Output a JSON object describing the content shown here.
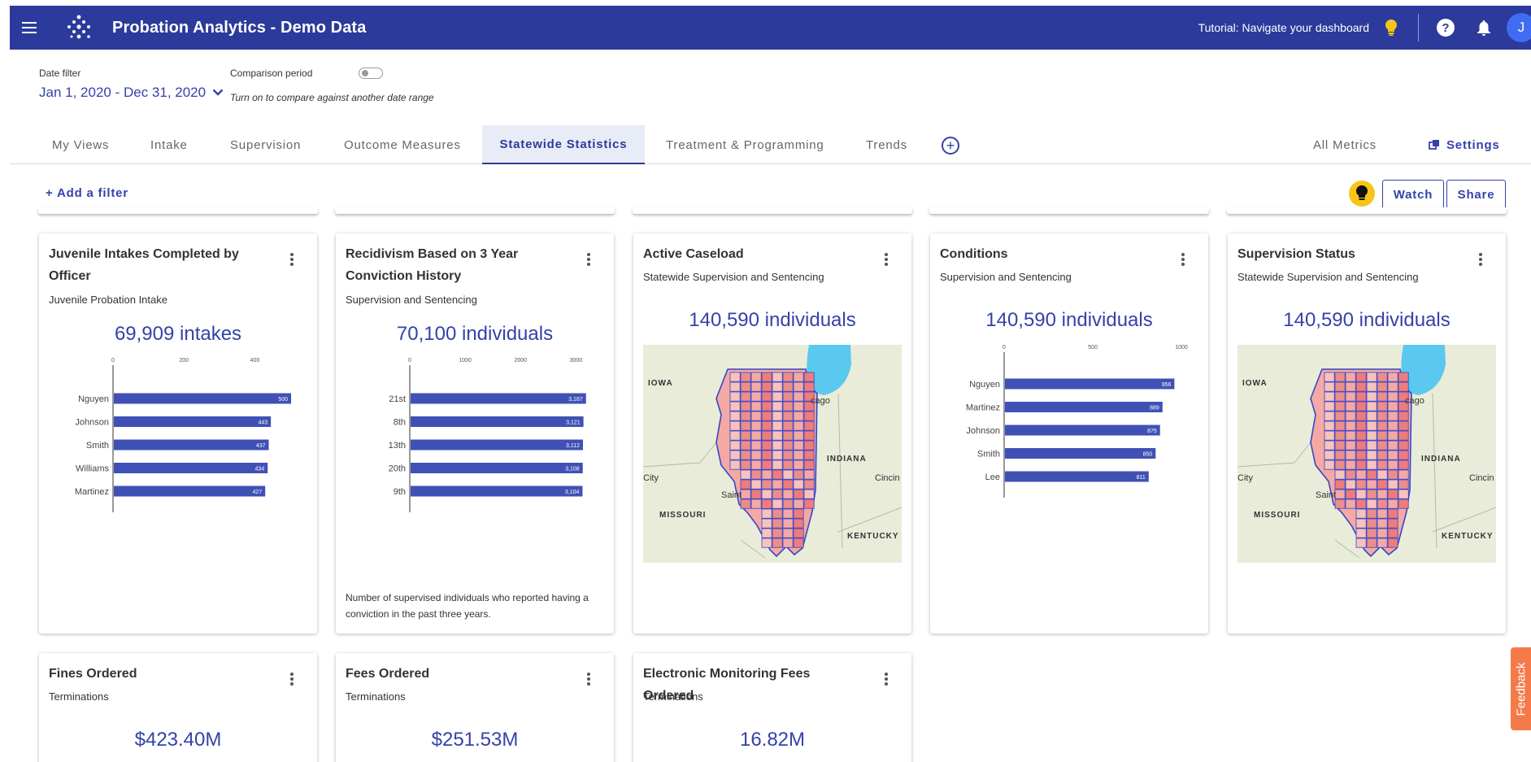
{
  "app": {
    "title": "Probation Analytics - Demo Data",
    "tutorial": "Tutorial: Navigate your dashboard",
    "avatar_initial": "J",
    "help_glyph": "?"
  },
  "filters": {
    "date_label": "Date filter",
    "date_value": "Jan 1, 2020 - Dec 31, 2020",
    "comparison_label": "Comparison period",
    "comparison_hint": "Turn on to compare against another date range",
    "comparison_on": false
  },
  "tabs": [
    {
      "label": "My Views",
      "active": false
    },
    {
      "label": "Intake",
      "active": false
    },
    {
      "label": "Supervision",
      "active": false
    },
    {
      "label": "Outcome Measures",
      "active": false
    },
    {
      "label": "Statewide Statistics",
      "active": true
    },
    {
      "label": "Treatment & Programming",
      "active": false
    },
    {
      "label": "Trends",
      "active": false
    }
  ],
  "tabs_right": {
    "all_metrics": "All Metrics",
    "settings": "Settings"
  },
  "toolbar": {
    "add_filter": "+ Add a filter",
    "watch": "Watch",
    "share": "Share"
  },
  "cards": [
    {
      "title": "Juvenile Intakes Completed by Officer",
      "subtitle": "Juvenile Probation Intake",
      "value": "69,909 intakes",
      "chart_data": {
        "type": "bar",
        "orientation": "horizontal",
        "categories": [
          "Nguyen",
          "Johnson",
          "Smith",
          "Williams",
          "Martinez"
        ],
        "values": [
          500,
          443,
          437,
          434,
          427
        ],
        "xticks": [
          "0",
          "200",
          "400"
        ],
        "xlim": [
          0,
          500
        ]
      }
    },
    {
      "title": "Recidivism Based on 3 Year Conviction History",
      "subtitle": "Supervision and Sentencing",
      "value": "70,100 individuals",
      "note": "Number of supervised individuals who reported having a conviction in the past three years.",
      "chart_data": {
        "type": "bar",
        "orientation": "horizontal",
        "categories": [
          "21st",
          "8th",
          "13th",
          "20th",
          "9th"
        ],
        "values": [
          3167,
          3121,
          3112,
          3108,
          3104
        ],
        "value_labels": [
          "3,167",
          "3,121",
          "3,112",
          "3,108",
          "3,104"
        ],
        "xticks": [
          "0",
          "1000",
          "2000",
          "3000"
        ],
        "xlim": [
          0,
          3200
        ]
      }
    },
    {
      "title": "Active Caseload",
      "subtitle": "Statewide Supervision and Sentencing",
      "value": "140,590 individuals",
      "map_labels": [
        "IOWA",
        "INDIANA",
        "MISSOURI",
        "KENTUCKY",
        "cago",
        "City",
        "Cincin",
        "Saint"
      ]
    },
    {
      "title": "Conditions",
      "subtitle": "Supervision and Sentencing",
      "value": "140,590 individuals",
      "chart_data": {
        "type": "bar",
        "orientation": "horizontal",
        "categories": [
          "Nguyen",
          "Martinez",
          "Johnson",
          "Smith",
          "Lee"
        ],
        "values": [
          956,
          889,
          875,
          850,
          811
        ],
        "xticks": [
          "0",
          "500",
          "1000"
        ],
        "xlim": [
          0,
          1000
        ]
      }
    },
    {
      "title": "Supervision Status",
      "subtitle": "Statewide Supervision and Sentencing",
      "value": "140,590 individuals",
      "map_labels": [
        "IOWA",
        "INDIANA",
        "MISSOURI",
        "KENTUCKY",
        "cago",
        "City",
        "Cincin",
        "Saint"
      ]
    },
    {
      "title": "Fines Ordered",
      "subtitle": "Terminations",
      "value": "$423.40M"
    },
    {
      "title": "Fees Ordered",
      "subtitle": "Terminations",
      "value": "$251.53M"
    },
    {
      "title": "Electronic Monitoring Fees Ordered",
      "subtitle": "Terminations",
      "value": "16.82M"
    }
  ],
  "feedback": "Feedback",
  "colors": {
    "primary": "#2c3a9b",
    "bar": "#4051b5",
    "accent": "#f7c418",
    "feedback": "#f47a4a"
  }
}
